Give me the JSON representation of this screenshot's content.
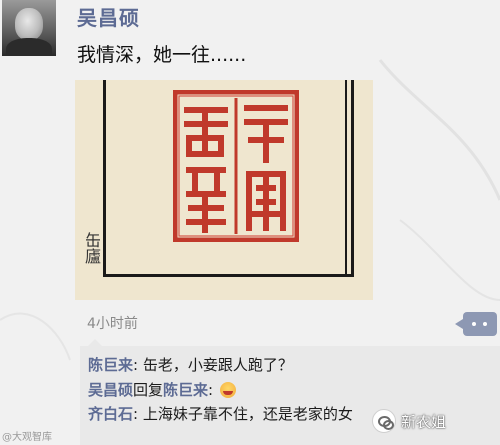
{
  "post": {
    "author": "吴昌硕",
    "text": "我情深，她一往......",
    "timestamp": "4小时前"
  },
  "image": {
    "corner_signature": "缶廬",
    "seal_glyphs": [
      "一往",
      "情深"
    ]
  },
  "comments": [
    {
      "author": "陈巨来",
      "text": "缶老，小妾跟人跑了？"
    },
    {
      "author": "吴昌硕",
      "reply_word": "回复",
      "reply_to": "陈巨来",
      "text": ":"
    },
    {
      "author": "齐白石",
      "text": "上海妹子靠不住，还是老家的女"
    }
  ],
  "watermarks": {
    "left": "@大观智库",
    "right": "新农姐"
  },
  "colors": {
    "name_link": "#5d6b94",
    "comment_bg": "#e9e9e9",
    "seal_red": "#c0392b",
    "paper": "#efe6cf"
  },
  "icons": {
    "more": "more-dots-icon",
    "emoji": "laughing-emoji-icon",
    "watermark_logo": "wechat-icon"
  }
}
